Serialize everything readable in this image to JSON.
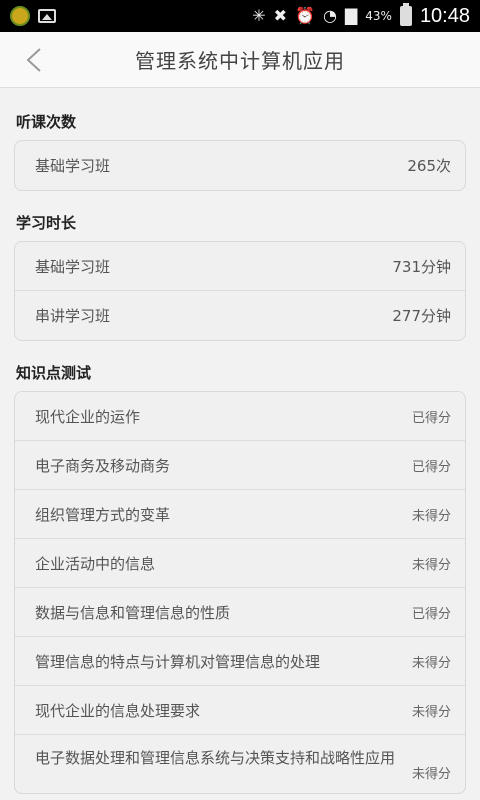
{
  "status_bar": {
    "icons": [
      "app-icon",
      "image-icon",
      "bluetooth-icon",
      "mute-icon",
      "alarm-icon",
      "wifi-icon",
      "signal-icon",
      "battery-icon"
    ],
    "battery": "43%",
    "time": "10:48"
  },
  "nav": {
    "title": "管理系统中计算机应用"
  },
  "sections": {
    "lecture_count": {
      "title": "听课次数",
      "rows": [
        {
          "label": "基础学习班",
          "value": "265次"
        }
      ]
    },
    "study_time": {
      "title": "学习时长",
      "rows": [
        {
          "label": "基础学习班",
          "value": "731分钟"
        },
        {
          "label": "串讲学习班",
          "value": "277分钟"
        }
      ]
    },
    "knowledge_test": {
      "title": "知识点测试",
      "rows": [
        {
          "label": "现代企业的运作",
          "status": "已得分"
        },
        {
          "label": "电子商务及移动商务",
          "status": "已得分"
        },
        {
          "label": "组织管理方式的变革",
          "status": "未得分"
        },
        {
          "label": "企业活动中的信息",
          "status": "未得分"
        },
        {
          "label": "数据与信息和管理信息的性质",
          "status": "已得分"
        },
        {
          "label": "管理信息的特点与计算机对管理信息的处理",
          "status": "未得分"
        },
        {
          "label": "现代企业的信息处理要求",
          "status": "未得分"
        },
        {
          "label": "电子数据处理和管理信息系统与决策支持和战略性应用",
          "status": "未得分"
        }
      ]
    }
  }
}
